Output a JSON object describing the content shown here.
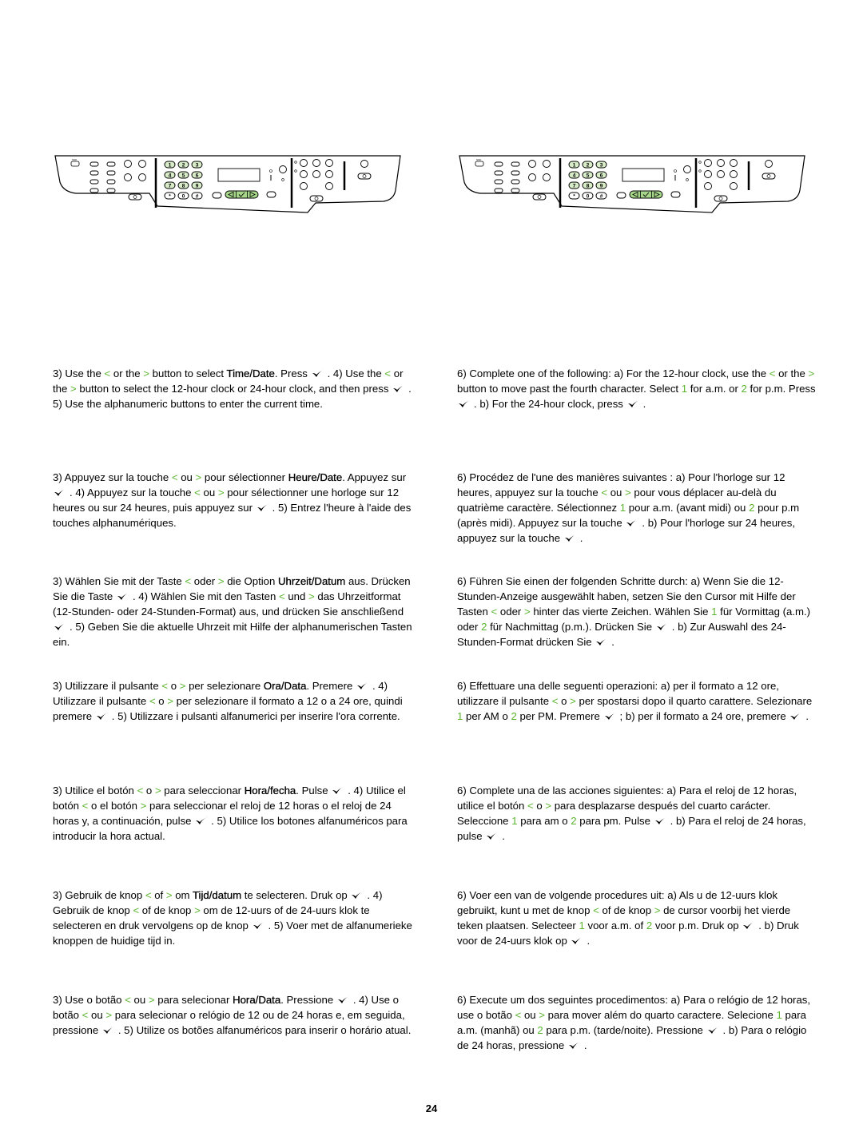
{
  "control_panels": [
    {
      "label": "control-panel-illustration-left",
      "keypad": [
        "1",
        "2",
        "3",
        "4",
        "5",
        "6",
        "7",
        "8",
        "9",
        "*",
        "0",
        "#"
      ],
      "shift_label": "Shift",
      "highlight_color": "#a6d68a",
      "highlight_keys": [
        "left-arrow",
        "ok-check",
        "right-arrow"
      ]
    },
    {
      "label": "control-panel-illustration-right",
      "keypad": [
        "1",
        "2",
        "3",
        "4",
        "5",
        "6",
        "7",
        "8",
        "9",
        "*",
        "0",
        "#"
      ],
      "shift_label": "Shift",
      "highlight_color": "#a6d68a",
      "highlight_keys": [
        "left-arrow",
        "ok-check",
        "right-arrow"
      ]
    }
  ],
  "accent_color": "#5ab52e",
  "sections": [
    {
      "lang": "en",
      "left": [
        {
          "t": "3) Use the "
        },
        {
          "g": "<"
        },
        {
          "t": " or the "
        },
        {
          "g": ">"
        },
        {
          "t": " button to select "
        },
        {
          "b": "Time/Date"
        },
        {
          "t": ". Press "
        },
        {
          "chk": true
        },
        {
          "t": ". 4) Use the "
        },
        {
          "g": "<"
        },
        {
          "t": " or the "
        },
        {
          "g": ">"
        },
        {
          "t": " button to select the 12-hour clock or 24-hour clock, and then press "
        },
        {
          "chk": true
        },
        {
          "t": ". 5) Use the alphanumeric buttons to enter the current time."
        }
      ],
      "right": [
        {
          "t": "6) Complete one of the following: a) For the 12-hour clock, use the "
        },
        {
          "g": "<"
        },
        {
          "t": " or the "
        },
        {
          "g": ">"
        },
        {
          "t": " button to move past the fourth character. Select "
        },
        {
          "g": "1"
        },
        {
          "t": " for a.m. or "
        },
        {
          "g": "2"
        },
        {
          "t": " for p.m. Press "
        },
        {
          "chk": true
        },
        {
          "t": ". b) For the 24-hour clock, press "
        },
        {
          "chk": true
        },
        {
          "t": "."
        }
      ]
    },
    {
      "lang": "fr",
      "left": [
        {
          "t": "3) Appuyez sur la touche "
        },
        {
          "g": "<"
        },
        {
          "t": " ou "
        },
        {
          "g": ">"
        },
        {
          "t": " pour sélectionner "
        },
        {
          "b": "Heure/Date"
        },
        {
          "t": ". Appuyez sur "
        },
        {
          "chk": true
        },
        {
          "t": ". 4) Appuyez sur la touche "
        },
        {
          "g": "<"
        },
        {
          "t": " ou "
        },
        {
          "g": ">"
        },
        {
          "t": " pour sélectionner une horloge sur 12 heures ou sur 24 heures, puis appuyez sur "
        },
        {
          "chk": true
        },
        {
          "t": ". 5) Entrez l'heure à l'aide des touches alphanumériques."
        }
      ],
      "right": [
        {
          "t": "6) Procédez de l'une des manières suivantes : a) Pour l'horloge sur 12 heures, appuyez sur la touche "
        },
        {
          "g": "<"
        },
        {
          "t": " ou "
        },
        {
          "g": ">"
        },
        {
          "t": " pour vous déplacer au-delà du quatrième caractère. Sélectionnez "
        },
        {
          "g": "1"
        },
        {
          "t": " pour a.m. (avant midi) ou "
        },
        {
          "g": "2"
        },
        {
          "t": " pour p.m (après midi). Appuyez sur la touche "
        },
        {
          "chk": true
        },
        {
          "t": ". b) Pour l'horloge sur 24 heures, appuyez sur la touche "
        },
        {
          "chk": true
        },
        {
          "t": "."
        }
      ]
    },
    {
      "lang": "de",
      "left": [
        {
          "t": "3) Wählen Sie mit der Taste "
        },
        {
          "g": "<"
        },
        {
          "t": " oder "
        },
        {
          "g": ">"
        },
        {
          "t": " die Option "
        },
        {
          "b": "Uhrzeit/Datum"
        },
        {
          "t": " aus. Drücken Sie die Taste "
        },
        {
          "chk": true
        },
        {
          "t": ". 4) Wählen Sie mit den Tasten "
        },
        {
          "g": "<"
        },
        {
          "t": " und "
        },
        {
          "g": ">"
        },
        {
          "t": " das Uhrzeitformat (12-Stunden- oder 24-Stunden-Format) aus, und drücken Sie anschließend "
        },
        {
          "chk": true
        },
        {
          "t": ". 5) Geben Sie die aktuelle Uhrzeit mit Hilfe der alphanumerischen Tasten ein."
        }
      ],
      "right": [
        {
          "t": "6) Führen Sie einen der folgenden Schritte durch: a) Wenn Sie die 12-Stunden-Anzeige ausgewählt haben, setzen Sie den Cursor mit Hilfe der Tasten "
        },
        {
          "g": "<"
        },
        {
          "t": " oder "
        },
        {
          "g": ">"
        },
        {
          "t": " hinter das vierte Zeichen. Wählen Sie "
        },
        {
          "g": "1"
        },
        {
          "t": " für Vormittag (a.m.) oder "
        },
        {
          "g": "2"
        },
        {
          "t": " für Nachmittag (p.m.). Drücken Sie "
        },
        {
          "chk": true
        },
        {
          "t": ". b) Zur Auswahl des 24-Stunden-Format drücken Sie "
        },
        {
          "chk": true
        },
        {
          "t": "."
        }
      ]
    },
    {
      "lang": "it",
      "left": [
        {
          "t": "3) Utilizzare il pulsante "
        },
        {
          "g": "<"
        },
        {
          "t": " o "
        },
        {
          "g": ">"
        },
        {
          "t": " per selezionare "
        },
        {
          "b": "Ora/Data"
        },
        {
          "t": ". Premere "
        },
        {
          "chk": true
        },
        {
          "t": ". 4) Utilizzare il pulsante "
        },
        {
          "g": "<"
        },
        {
          "t": " o "
        },
        {
          "g": ">"
        },
        {
          "t": " per selezionare il formato a 12 o a 24 ore, quindi premere "
        },
        {
          "chk": true
        },
        {
          "t": ". 5) Utilizzare i pulsanti alfanumerici per inserire l'ora corrente."
        }
      ],
      "right": [
        {
          "t": "6) Effettuare una delle seguenti operazioni: a) per il formato a 12 ore, utilizzare il pulsante "
        },
        {
          "g": "<"
        },
        {
          "t": " o "
        },
        {
          "g": ">"
        },
        {
          "t": " per spostarsi dopo il quarto carattere. Selezionare "
        },
        {
          "g": "1"
        },
        {
          "t": " per AM o "
        },
        {
          "g": "2"
        },
        {
          "t": " per PM. Premere "
        },
        {
          "chk": true
        },
        {
          "t": "; b) per il formato a 24 ore, premere "
        },
        {
          "chk": true
        },
        {
          "t": "."
        }
      ]
    },
    {
      "lang": "es",
      "left": [
        {
          "t": "3) Utilice el botón "
        },
        {
          "g": "<"
        },
        {
          "t": " o "
        },
        {
          "g": ">"
        },
        {
          "t": " para seleccionar "
        },
        {
          "b": "Hora/fecha"
        },
        {
          "t": ". Pulse "
        },
        {
          "chk": true
        },
        {
          "t": ". 4) Utilice el botón "
        },
        {
          "g": "<"
        },
        {
          "t": " o el botón "
        },
        {
          "g": ">"
        },
        {
          "t": " para seleccionar el reloj de 12 horas o el reloj de 24 horas y, a continuación, pulse "
        },
        {
          "chk": true
        },
        {
          "t": ". 5) Utilice los botones alfanuméricos para introducir la hora actual."
        }
      ],
      "right": [
        {
          "t": "6) Complete una de las acciones siguientes: a) Para el reloj de 12 horas, utilice el botón "
        },
        {
          "g": "<"
        },
        {
          "t": " o "
        },
        {
          "g": ">"
        },
        {
          "t": " para desplazarse después del cuarto carácter. Seleccione "
        },
        {
          "g": "1"
        },
        {
          "t": " para am o "
        },
        {
          "g": "2"
        },
        {
          "t": " para pm. Pulse "
        },
        {
          "chk": true
        },
        {
          "t": ". b) Para el reloj de 24 horas, pulse "
        },
        {
          "chk": true
        },
        {
          "t": "."
        }
      ]
    },
    {
      "lang": "nl",
      "left": [
        {
          "t": "3) Gebruik de knop "
        },
        {
          "g": "<"
        },
        {
          "t": " of "
        },
        {
          "g": ">"
        },
        {
          "t": " om "
        },
        {
          "b": "Tijd/datum"
        },
        {
          "t": " te selecteren. Druk op "
        },
        {
          "chk": true
        },
        {
          "t": ". 4) Gebruik de knop "
        },
        {
          "g": "<"
        },
        {
          "t": " of de knop "
        },
        {
          "g": ">"
        },
        {
          "t": " om de 12-uurs of de 24-uurs klok te selecteren en druk vervolgens op de knop "
        },
        {
          "chk": true
        },
        {
          "t": ". 5) Voer met de alfanumerieke knoppen de huidige tijd in."
        }
      ],
      "right": [
        {
          "t": "6) Voer een van de volgende procedures uit: a) Als u de 12-uurs klok gebruikt, kunt u met de knop "
        },
        {
          "g": "<"
        },
        {
          "t": " of de knop "
        },
        {
          "g": ">"
        },
        {
          "t": " de cursor voorbij het vierde teken plaatsen. Selecteer "
        },
        {
          "g": "1"
        },
        {
          "t": " voor a.m. of "
        },
        {
          "g": "2"
        },
        {
          "t": " voor p.m. Druk op "
        },
        {
          "chk": true
        },
        {
          "t": ". b) Druk voor de 24-uurs klok op "
        },
        {
          "chk": true
        },
        {
          "t": "."
        }
      ]
    },
    {
      "lang": "pt",
      "left": [
        {
          "t": "3) Use o botão "
        },
        {
          "g": "<"
        },
        {
          "t": " ou "
        },
        {
          "g": ">"
        },
        {
          "t": " para selecionar "
        },
        {
          "b": "Hora/Data"
        },
        {
          "t": ". Pressione "
        },
        {
          "chk": true
        },
        {
          "t": ". 4) Use o botão "
        },
        {
          "g": "<"
        },
        {
          "t": " ou "
        },
        {
          "g": ">"
        },
        {
          "t": " para selecionar o relógio de 12 ou de 24 horas e, em seguida, pressione "
        },
        {
          "chk": true
        },
        {
          "t": ". 5) Utilize os botões alfanuméricos para inserir o horário atual."
        }
      ],
      "right": [
        {
          "t": "6) Execute um dos seguintes procedimentos: a) Para o relógio de 12 horas, use o botão "
        },
        {
          "g": "<"
        },
        {
          "t": " ou "
        },
        {
          "g": ">"
        },
        {
          "t": " para mover além do quarto caractere. Selecione "
        },
        {
          "g": "1"
        },
        {
          "t": " para a.m. (manhã) ou "
        },
        {
          "g": "2"
        },
        {
          "t": " para p.m. (tarde/noite). Pressione "
        },
        {
          "chk": true
        },
        {
          "t": ". b) Para o relógio de 24 horas, pressione "
        },
        {
          "chk": true
        },
        {
          "t": "."
        }
      ]
    }
  ],
  "page_number": "24"
}
